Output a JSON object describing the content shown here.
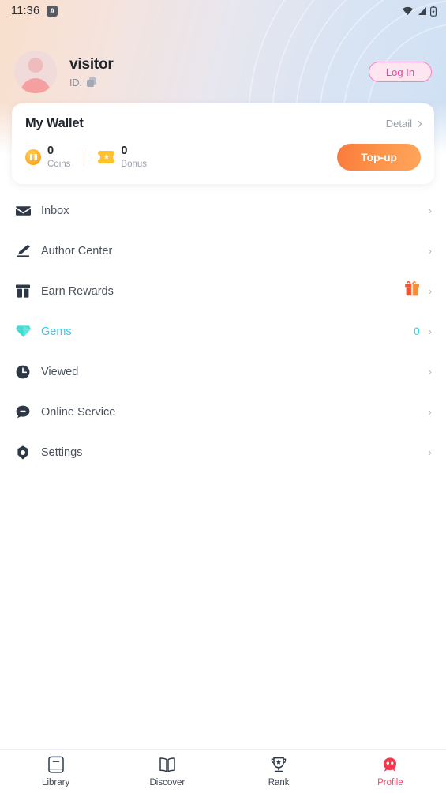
{
  "status_bar": {
    "time": "11:36",
    "app_badge": "A",
    "icons": [
      "wifi-icon",
      "cellular-signal-icon",
      "battery-icon"
    ]
  },
  "profile": {
    "username": "visitor",
    "id_label": "ID:",
    "id_copy_icon": "copy-icon",
    "avatar_icon": "avatar-placeholder",
    "login_button": "Log In"
  },
  "wallet": {
    "title": "My Wallet",
    "detail_link": "Detail",
    "coins": {
      "value": "0",
      "label": "Coins",
      "icon": "coin-icon"
    },
    "bonus": {
      "value": "0",
      "label": "Bonus",
      "icon": "ticket-icon"
    },
    "topup_button": "Top-up"
  },
  "menu": {
    "items": [
      {
        "label": "Inbox",
        "icon": "envelope-icon",
        "count": "",
        "badge_icon": "",
        "accent": false
      },
      {
        "label": "Author Center",
        "icon": "pen-icon",
        "count": "",
        "badge_icon": "",
        "accent": false
      },
      {
        "label": "Earn Rewards",
        "icon": "gift-icon",
        "count": "",
        "badge_icon": "gift-box-icon",
        "accent": false
      },
      {
        "label": "Gems",
        "icon": "gem-icon",
        "count": "0",
        "badge_icon": "",
        "accent": true
      },
      {
        "label": "Viewed",
        "icon": "clock-icon",
        "count": "",
        "badge_icon": "",
        "accent": false
      },
      {
        "label": "Online Service",
        "icon": "chat-icon",
        "count": "",
        "badge_icon": "",
        "accent": false
      },
      {
        "label": "Settings",
        "icon": "gear-icon",
        "count": "",
        "badge_icon": "",
        "accent": false
      }
    ]
  },
  "bottom_nav": {
    "items": [
      {
        "label": "Library",
        "icon": "library-icon",
        "active": false
      },
      {
        "label": "Discover",
        "icon": "book-icon",
        "active": false
      },
      {
        "label": "Rank",
        "icon": "trophy-icon",
        "active": false
      },
      {
        "label": "Profile",
        "icon": "profile-icon",
        "active": true
      }
    ]
  },
  "colors": {
    "accent_pink": "#f3419a",
    "accent_cyan": "#2ccdf0",
    "accent_orange": "#fa7a3c",
    "active_tab": "#f04a6e",
    "text_primary": "#20242c",
    "text_secondary": "#9aa0ab"
  }
}
